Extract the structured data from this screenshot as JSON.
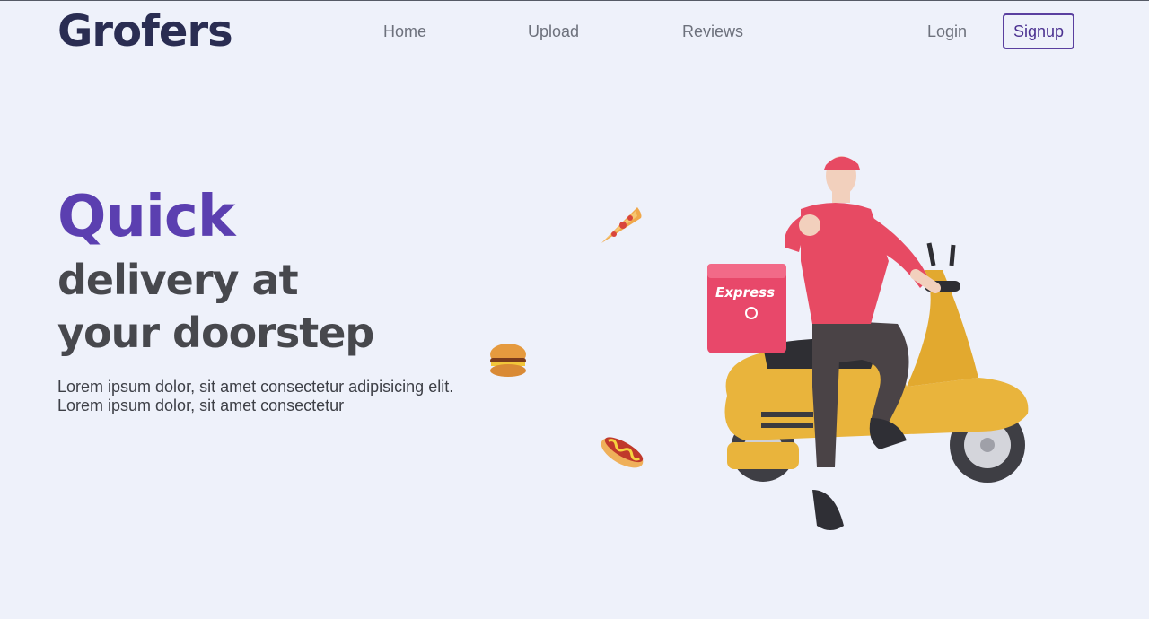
{
  "header": {
    "logo": "Grofers",
    "nav": [
      "Home",
      "Upload",
      "Reviews"
    ],
    "login_label": "Login",
    "signup_label": "Signup"
  },
  "hero": {
    "highlight": "Quick",
    "line1": "delivery at",
    "line2": "your doorstep",
    "description_line1": "Lorem ipsum dolor, sit amet consectetur adipisicing elit.",
    "description_line2": "Lorem ipsum dolor, sit amet consectetur",
    "box_text": "Express"
  },
  "colors": {
    "background": "#eef1fa",
    "brand": "#2a2d52",
    "accent": "#5b3fb0",
    "box": "#e8486a",
    "scooter": "#e9b43c"
  },
  "icons": [
    "pizza-icon",
    "burger-icon",
    "hotdog-icon",
    "delivery-scooter-illustration"
  ]
}
